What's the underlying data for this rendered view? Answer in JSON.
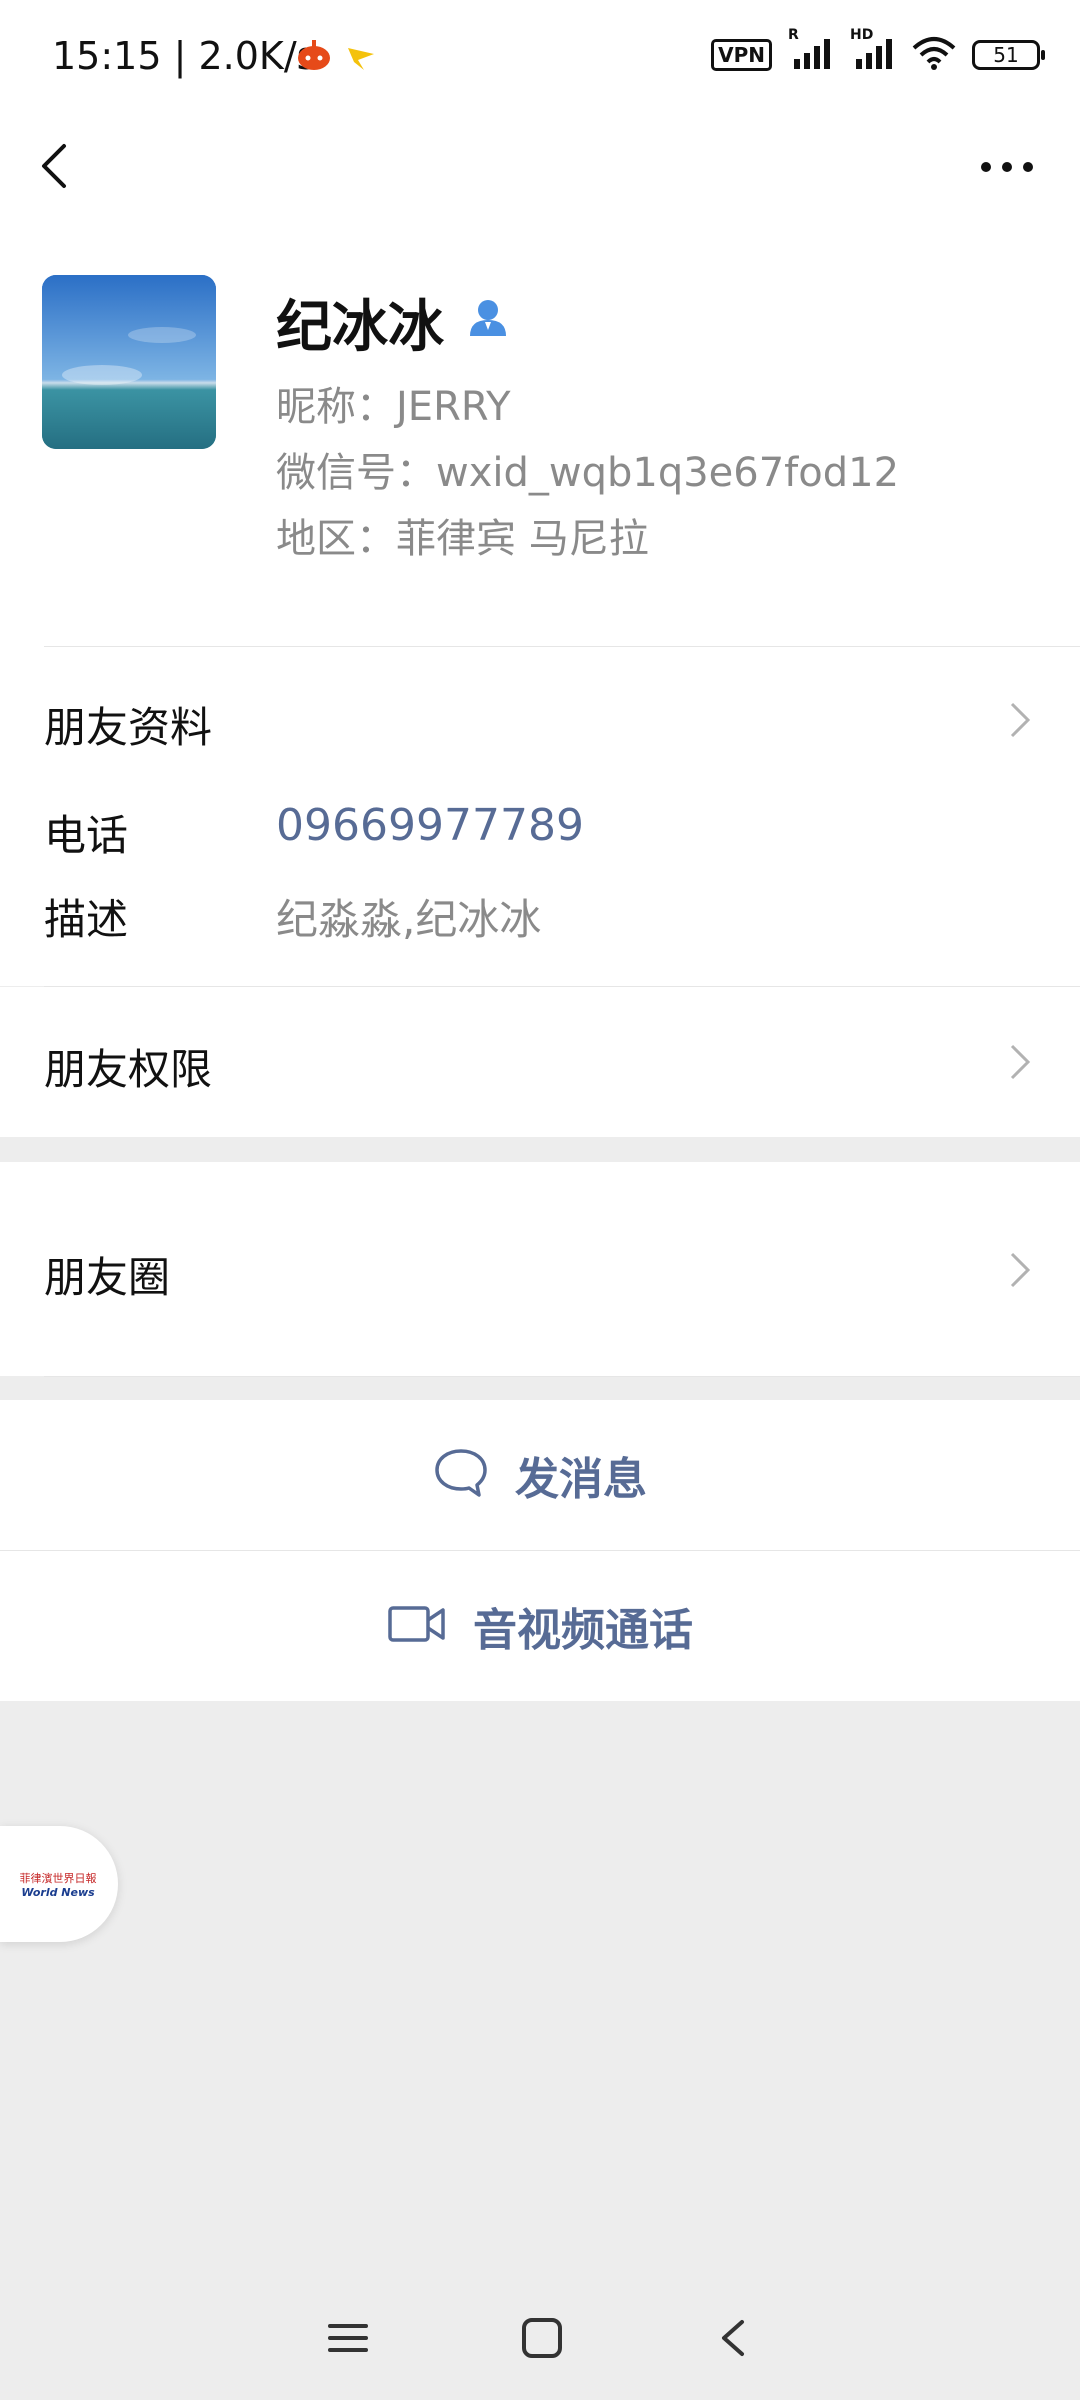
{
  "status_bar": {
    "time": "15:15",
    "network_speed": "2.0K/s",
    "vpn": "VPN",
    "signal_tag_1": "R",
    "signal_tag_2": "HD",
    "battery": "51"
  },
  "profile": {
    "name": "纪冰冰",
    "nickname": "昵称：JERRY",
    "wechat_id": "微信号：wxid_wqb1q3e67fod12",
    "region": "地区：菲律宾  马尼拉"
  },
  "friend_info": {
    "title": "朋友资料",
    "phone_label": "电话",
    "phone_value": "09669977789",
    "desc_label": "描述",
    "desc_value": "纪淼淼,纪冰冰"
  },
  "permissions": {
    "title": "朋友权限"
  },
  "moments": {
    "title": "朋友圈"
  },
  "actions": {
    "send_message": "发消息",
    "video_call": "音视频通话"
  },
  "floating_badge": {
    "line1": "菲律濱世界日報",
    "line2": "World News"
  },
  "colors": {
    "link_blue": "#576b95",
    "background_gray": "#ededed",
    "secondary_text": "#8a8a8a"
  }
}
